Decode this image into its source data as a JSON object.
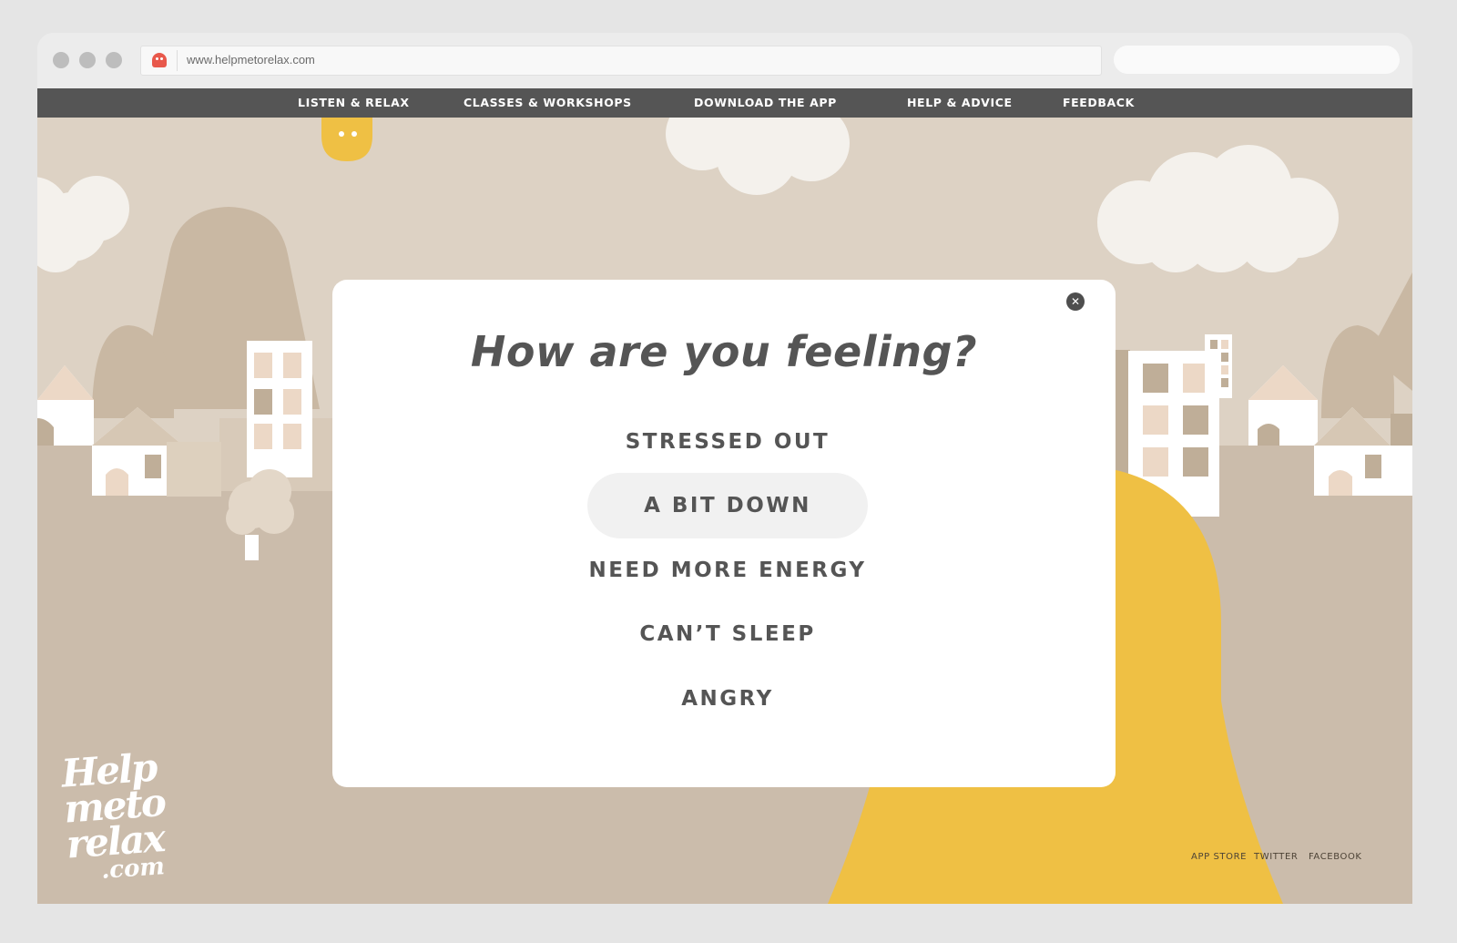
{
  "browser": {
    "url": "www.helpmetorelax.com",
    "window_buttons": [
      "close",
      "minimize",
      "zoom"
    ]
  },
  "nav": {
    "items": [
      {
        "label": "LISTEN & RELAX"
      },
      {
        "label": "CLASSES & WORKSHOPS"
      },
      {
        "label": "DOWNLOAD THE APP"
      },
      {
        "label": "HELP & ADVICE"
      },
      {
        "label": "FEEDBACK"
      }
    ]
  },
  "modal": {
    "title": "How are you feeling?",
    "close_icon": "close-icon",
    "close_symbol": "✕",
    "options": [
      {
        "label": "STRESSED OUT",
        "selected": false
      },
      {
        "label": "A BIT DOWN",
        "selected": true
      },
      {
        "label": "NEED MORE ENERGY",
        "selected": false
      },
      {
        "label": "CAN’T SLEEP",
        "selected": false
      },
      {
        "label": "ANGRY",
        "selected": false
      }
    ]
  },
  "logo": {
    "line1": "Help",
    "line2": "meto",
    "line3": "relax",
    "line4": ".com"
  },
  "footer": {
    "links": [
      {
        "label": "APP STORE"
      },
      {
        "label": "TWITTER"
      },
      {
        "label": "FACEBOOK"
      }
    ]
  },
  "colors": {
    "nav_bg": "#555555",
    "sky": "#ddd2c4",
    "ground": "#cbbcab",
    "mascot": "#efc044",
    "text": "#555555"
  }
}
